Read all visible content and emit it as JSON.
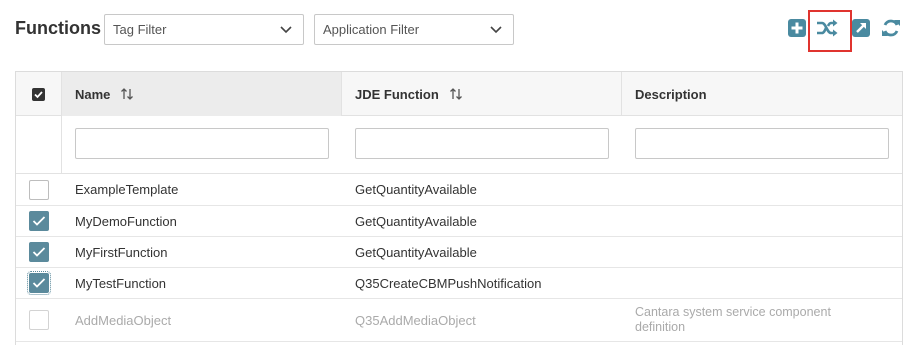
{
  "header": {
    "title": "Functions",
    "tag_filter_placeholder": "Tag Filter",
    "application_filter_placeholder": "Application Filter"
  },
  "toolbar": {
    "icons": [
      "plus-square-icon",
      "shuffle-icon",
      "external-link-icon",
      "refresh-icon"
    ],
    "accent_color": "#4a8aa0",
    "highlight_color": "#e0342f"
  },
  "grid": {
    "columns": [
      {
        "label": "Name",
        "sortable": true
      },
      {
        "label": "JDE Function",
        "sortable": true
      },
      {
        "label": "Description",
        "sortable": false
      }
    ],
    "select_all_checked": true,
    "rows": [
      {
        "name": "ExampleTemplate",
        "jde_function": "GetQuantityAvailable",
        "description": "",
        "checked": false,
        "disabled": false
      },
      {
        "name": "MyDemoFunction",
        "jde_function": "GetQuantityAvailable",
        "description": "",
        "checked": true,
        "disabled": false
      },
      {
        "name": "MyFirstFunction",
        "jde_function": "GetQuantityAvailable",
        "description": "",
        "checked": true,
        "disabled": false
      },
      {
        "name": "MyTestFunction",
        "jde_function": "Q35CreateCBMPushNotification",
        "description": "",
        "checked": true,
        "disabled": false
      },
      {
        "name": "AddMediaObject",
        "jde_function": "Q35AddMediaObject",
        "description": "Cantara system service component definition",
        "checked": false,
        "disabled": true
      }
    ],
    "checkbox_color": "#5b8a9c"
  }
}
